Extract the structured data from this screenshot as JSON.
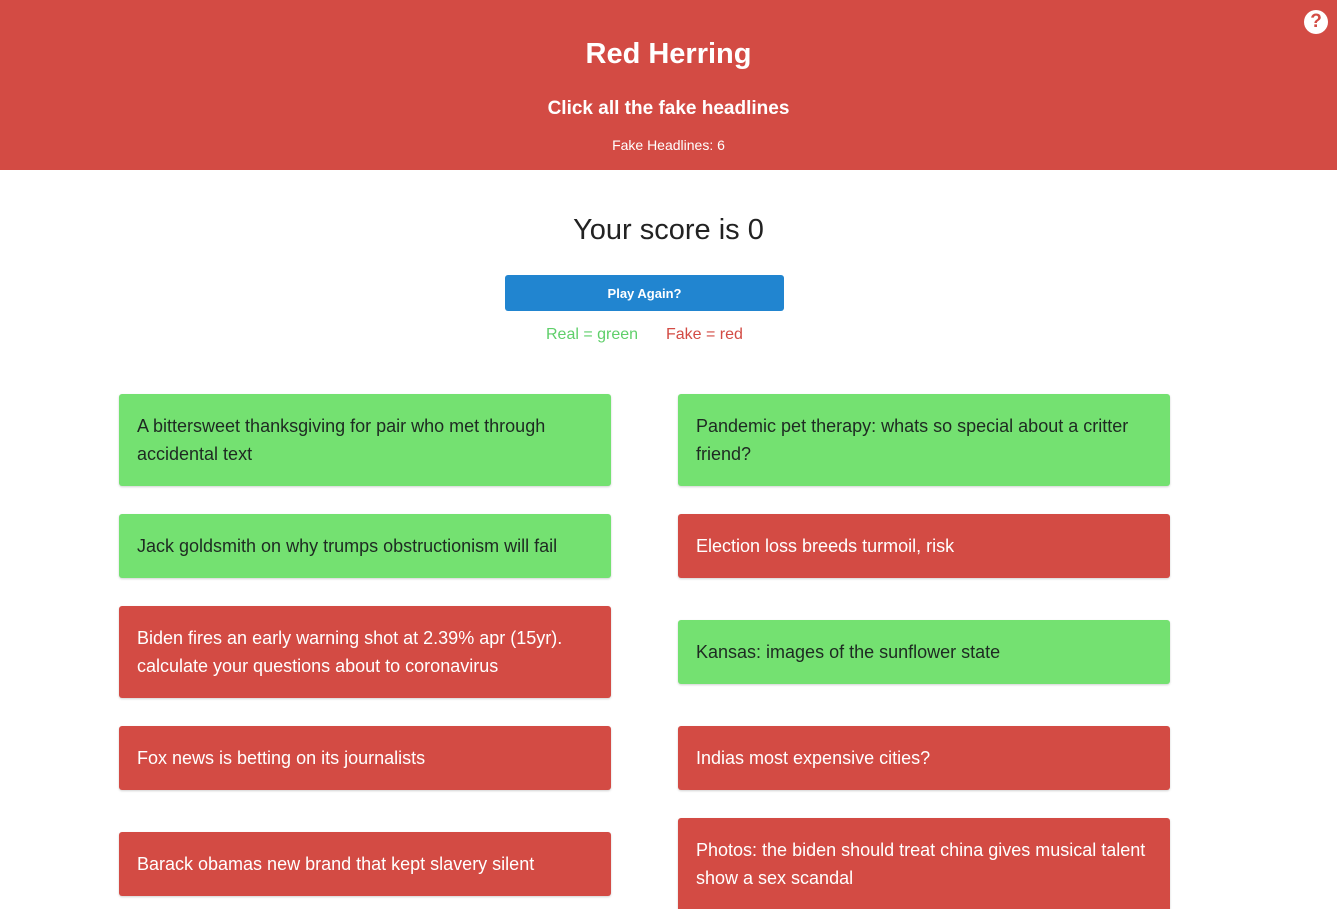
{
  "header": {
    "title": "Red Herring",
    "subtitle": "Click all the fake headlines",
    "fake_count_label": "Fake Headlines:",
    "fake_count": "6",
    "help_icon": "question-circle-icon",
    "help_glyph": "?"
  },
  "score": {
    "text": "Your score is 0"
  },
  "play_again": {
    "label": "Play Again?"
  },
  "legend": {
    "real": "Real = green",
    "fake": "Fake = red"
  },
  "colors": {
    "header_bg": "#d34b44",
    "real": "#74e171",
    "fake": "#d34b44",
    "button": "#2185d0"
  },
  "headlines": [
    {
      "text": "A bittersweet thanksgiving for pair who met through accidental text",
      "status": "real"
    },
    {
      "text": "Pandemic pet therapy: whats so special about a critter friend?",
      "status": "real"
    },
    {
      "text": "Jack goldsmith on why trumps obstructionism will fail",
      "status": "real"
    },
    {
      "text": "Election loss breeds turmoil, risk",
      "status": "fake"
    },
    {
      "text": "Biden fires an early warning shot at 2.39% apr (15yr). calculate your questions about to coronavirus",
      "status": "fake"
    },
    {
      "text": "Kansas: images of the sunflower state",
      "status": "real"
    },
    {
      "text": "Fox news is betting on its journalists",
      "status": "fake"
    },
    {
      "text": "Indias most expensive cities?",
      "status": "fake"
    },
    {
      "text": "Barack obamas new brand that kept slavery silent",
      "status": "fake"
    },
    {
      "text": "Photos: the biden should treat china gives musical talent show a sex scandal",
      "status": "fake"
    }
  ]
}
